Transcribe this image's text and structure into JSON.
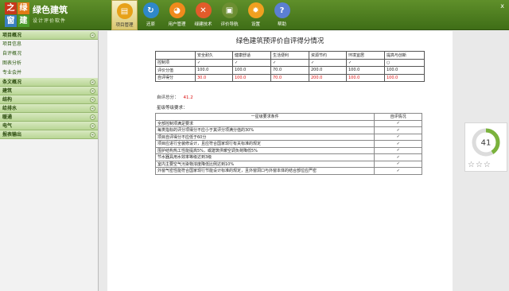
{
  "app": {
    "logo_chars": [
      "之",
      "绿",
      "窗",
      "建"
    ],
    "title": "绿色建筑",
    "subtitle": "设计评价软件",
    "close_icon": "x"
  },
  "toolbar": [
    {
      "label": "项目管理",
      "icon": "project-icon",
      "color": "#e7a118",
      "glyph": "▤",
      "active": true
    },
    {
      "label": "还原",
      "icon": "restore-icon",
      "color": "#2f88c9",
      "glyph": "↻",
      "active": false
    },
    {
      "label": "用户管理",
      "icon": "users-icon",
      "color": "#f08a1c",
      "glyph": "◕",
      "active": false
    },
    {
      "label": "绿建技术",
      "icon": "tools-icon",
      "color": "#e25b2a",
      "glyph": "✕",
      "active": false
    },
    {
      "label": "评价导航",
      "icon": "guide-icon",
      "color": "#6d8f32",
      "glyph": "▣",
      "active": false
    },
    {
      "label": "设置",
      "icon": "settings-icon",
      "color": "#f0a020",
      "glyph": "✹",
      "active": false
    },
    {
      "label": "帮助",
      "icon": "help-icon",
      "color": "#5b7fd2",
      "glyph": "?",
      "active": false
    }
  ],
  "sidebar": {
    "sections": [
      {
        "label": "项目概况",
        "items": [
          "项目信息",
          "自评概况",
          "图表分析",
          "专业会并"
        ]
      },
      {
        "label": "条文概况",
        "items": []
      },
      {
        "label": "建筑",
        "items": []
      },
      {
        "label": "结构",
        "items": []
      },
      {
        "label": "给排水",
        "items": []
      },
      {
        "label": "暖通",
        "items": []
      },
      {
        "label": "电气",
        "items": []
      },
      {
        "label": "报表输出",
        "items": []
      }
    ]
  },
  "report": {
    "title": "绿色建筑预评价自评得分情况",
    "score_table": {
      "headers": [
        "",
        "安全耐久",
        "健康舒适",
        "生活便利",
        "资源节约",
        "环境宜居",
        "提高与创新"
      ],
      "rows": [
        {
          "label": "控制项",
          "cells": [
            "✓",
            "✓",
            "✓",
            "✓",
            "✓",
            "○"
          ],
          "red": false
        },
        {
          "label": "评价分值",
          "cells": [
            "100.0",
            "100.0",
            "70.0",
            "200.0",
            "100.0",
            "100.0"
          ],
          "red": false
        },
        {
          "label": "自评得分",
          "cells": [
            "30.0",
            "100.0",
            "70.0",
            "200.0",
            "100.0",
            "100.0"
          ],
          "red": true
        }
      ]
    },
    "self_score_label": "自评总分：",
    "self_score_value": "41.2",
    "star_req_label": "星级等级要求：",
    "req_table": {
      "headers": [
        "一星级要求条件",
        "自评情况"
      ],
      "rows": [
        {
          "text": "全部控制项满足要求",
          "check": "✓"
        },
        {
          "text": "每类指标的评分项得分不应小于其评分项满分值的30%",
          "check": "✓"
        },
        {
          "text": "项目自评得分不应低于60分",
          "check": "✓"
        },
        {
          "text": "项目应进行全装修设计，且应符合国家现行有关标准的规定",
          "check": "✓"
        },
        {
          "text": "围护结构热工性能提高5%，或建筑供暖空调负荷降低5%",
          "check": "✓"
        },
        {
          "text": "节水器具用水效率等级达到3级",
          "check": "✓"
        },
        {
          "text": "室内主要空气污染物浓度降低比例达到10%",
          "check": "✓"
        },
        {
          "text": "外窗气密性能符合国家现行节能设计标准的规定，且外窗洞口与外窗本体的结合部位应严密",
          "check": "✓"
        }
      ]
    }
  },
  "widget": {
    "score": "41",
    "progress": 0.41,
    "ring_color": "#7ab23c",
    "stars": "☆☆☆"
  }
}
